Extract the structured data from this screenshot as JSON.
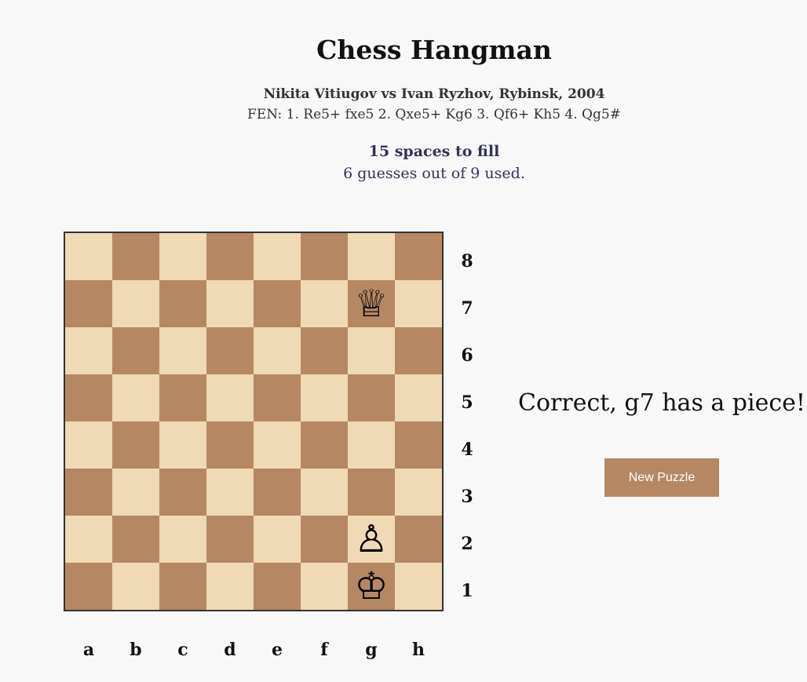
{
  "header": {
    "title": "Chess Hangman",
    "game_name": "Nikita Vitiugov vs Ivan Ryzhov, Rybinsk, 2004",
    "fen": "FEN: 1. Re5+ fxe5 2. Qxe5+ Kg6 3. Qf6+ Kh5 4. Qg5#",
    "spaces_to_fill": "15 spaces to fill",
    "guesses_used": "6 guesses out of 9 used."
  },
  "board": {
    "ranks": [
      "8",
      "7",
      "6",
      "5",
      "4",
      "3",
      "2",
      "1"
    ],
    "files": [
      "a",
      "b",
      "c",
      "d",
      "e",
      "f",
      "g",
      "h"
    ],
    "light_color": "#f0d9b5",
    "dark_color": "#b58863",
    "pieces": [
      {
        "square": "g7",
        "glyph": "♕",
        "name": "white-queen"
      },
      {
        "square": "g2",
        "glyph": "♙",
        "name": "white-pawn"
      },
      {
        "square": "g1",
        "glyph": "♔",
        "name": "white-king"
      }
    ]
  },
  "status": {
    "message": "Correct, g7 has a piece!"
  },
  "controls": {
    "new_puzzle_label": "New Puzzle",
    "button_color": "#b58863"
  }
}
